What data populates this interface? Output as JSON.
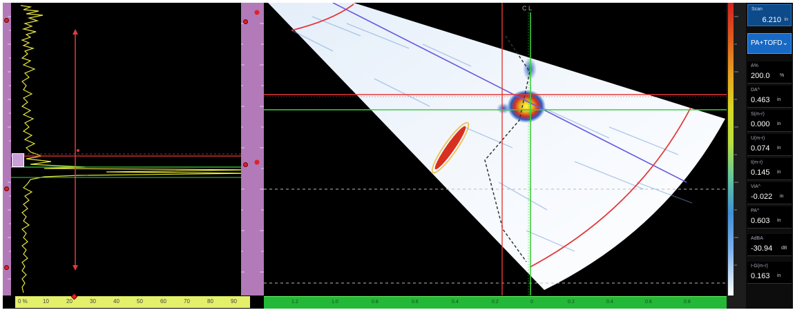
{
  "scan": {
    "label": "Scan",
    "value": "6.210",
    "unit": "in"
  },
  "mode_select": {
    "selected": "PA+TOFD"
  },
  "readings": [
    {
      "label": "A%",
      "value": "200.0",
      "unit": "%"
    },
    {
      "label": "DA^",
      "value": "0.463",
      "unit": "in"
    },
    {
      "label": "S(m-r)",
      "value": "0.000",
      "unit": "in"
    },
    {
      "label": "U(m-r)",
      "value": "0.074",
      "unit": "in"
    },
    {
      "label": "I(m-r)",
      "value": "0.145",
      "unit": "in"
    },
    {
      "label": "ViA^",
      "value": "-0.022",
      "unit": "in"
    },
    {
      "label": "PA^",
      "value": "0.603",
      "unit": "in"
    },
    {
      "label": "AdBA",
      "value": "-30.94",
      "unit": "dB"
    },
    {
      "label": "I-G(m-r)",
      "value": "0.163",
      "unit": "in"
    }
  ],
  "ascan": {
    "amplitude_scale": [
      "0 %",
      "10",
      "20",
      "30",
      "40",
      "50",
      "60",
      "70",
      "80",
      "90"
    ]
  },
  "sscan": {
    "centerline_label": "C L",
    "index_scale": [
      "1.2",
      "1.0",
      "0.8",
      "0.6",
      "0.4",
      "0.2",
      "0",
      "0.2",
      "0.4",
      "0.6",
      "0.8"
    ]
  },
  "colors": {
    "cursor_red": "#e23a3a",
    "cursor_green": "#3ccf3c",
    "beam_blue": "#6a5ae0",
    "signal_yellow": "#e6e640",
    "ruler_purple": "#b27ab8",
    "scale_green": "#23b837",
    "mode_blue": "#1769c4"
  },
  "icons": {
    "mode_chevron": "chevron-down-icon"
  }
}
